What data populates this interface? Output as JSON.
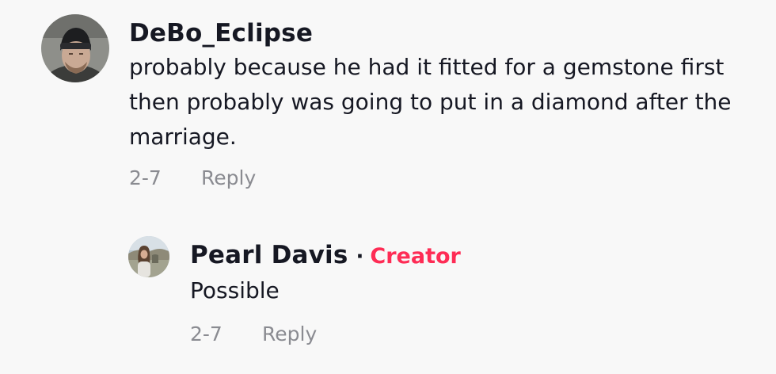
{
  "comments": [
    {
      "username": "DeBo_Eclipse",
      "text": "probably because he had it fitted for a gemstone first then probably was going to put in a diamond after the marriage.",
      "date": "2-7",
      "reply_label": "Reply",
      "avatar_icon": "user-avatar-beanie"
    }
  ],
  "replies": [
    {
      "username": "Pearl Davis",
      "separator": "·",
      "badge": "Creator",
      "text": "Possible",
      "date": "2-7",
      "reply_label": "Reply",
      "avatar_icon": "user-avatar-outdoor"
    }
  ],
  "colors": {
    "background": "#f8f8f8",
    "text": "#161823",
    "muted": "#8a8b91",
    "creator_badge": "#fe2c55"
  }
}
